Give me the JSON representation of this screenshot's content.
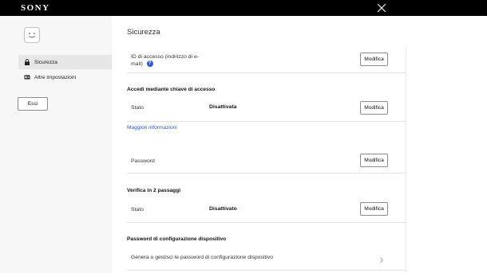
{
  "header": {
    "logo_text": "SONY",
    "close_icon": "close-icon"
  },
  "sidebar": {
    "avatar_icon": "smiley-avatar-icon",
    "items": [
      {
        "label": "Sicurezza",
        "icon": "lock-icon",
        "active": true
      },
      {
        "label": "Altre impostazioni",
        "icon": "id-card-icon",
        "active": false
      }
    ],
    "logout_label": "Esci"
  },
  "main": {
    "title": "Sicurezza",
    "id_row": {
      "label_line1": "ID di accesso (indirizzo di e-",
      "label_line2": "mail)",
      "help_icon": "question-icon",
      "button": "Modifica"
    },
    "passkey": {
      "heading": "Accedi mediante chiave di accesso",
      "status_label": "Stato",
      "status_value": "Disattivata",
      "button": "Modifica",
      "more_link": "Maggiori informazioni"
    },
    "password_row": {
      "label": "Password",
      "button": "Modifica"
    },
    "two_step": {
      "heading": "Verifica in 2 passaggi",
      "status_label": "Stato",
      "status_value": "Disattivato",
      "button": "Modifica"
    },
    "device_password": {
      "heading": "Password di configurazione dispositivo",
      "row_label": "Genera o gestisci le password di configurazione dispositivo",
      "chevron_icon": "chevron-right-icon"
    }
  }
}
